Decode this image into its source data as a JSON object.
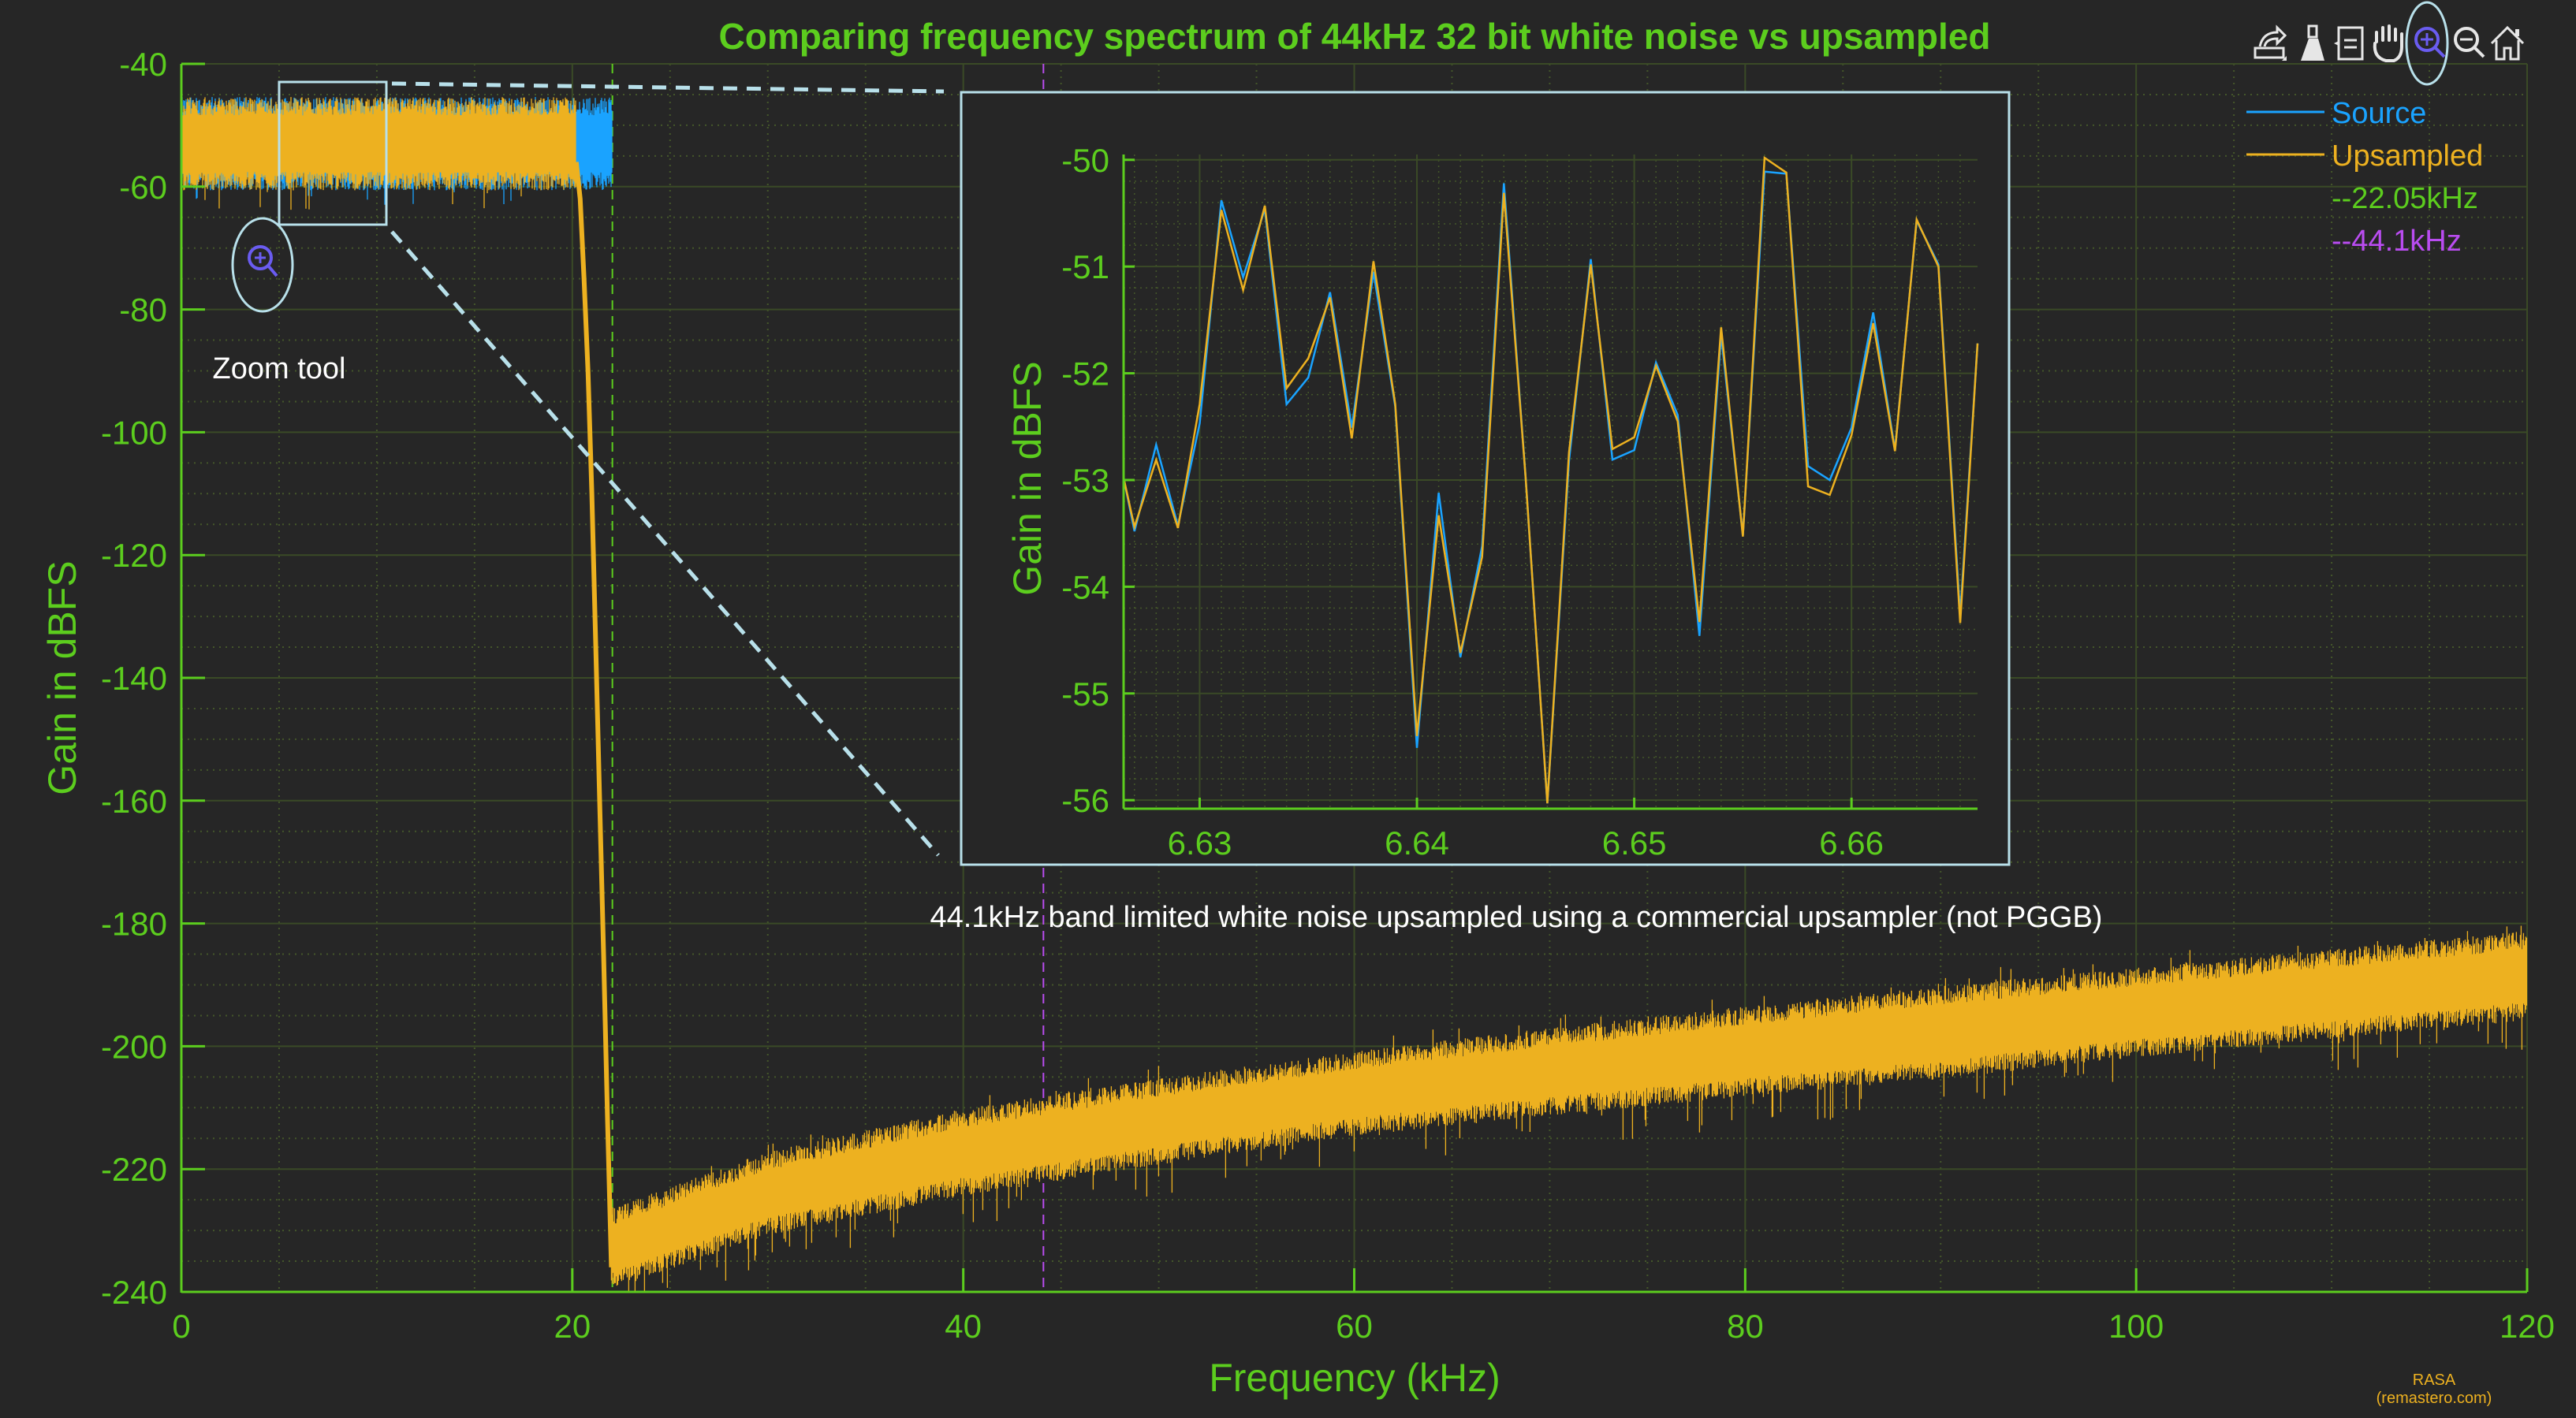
{
  "colors": {
    "background": "#262626",
    "axis": "#5ccd1e",
    "grid_major": "#3a4a26",
    "grid_minor": "#44562a",
    "source": "#1aa3ff",
    "upsampled": "#edb120",
    "marker_22k": "#5ccd1e",
    "marker_44k": "#b94cf0",
    "annotation": "#b8e0ea",
    "zoom_icon": "#6a5cf0",
    "text_white": "#ffffff",
    "credit": "#edb120"
  },
  "toolbar": {
    "items": [
      {
        "name": "export-icon",
        "label": "Export"
      },
      {
        "name": "brush-icon",
        "label": "Brush"
      },
      {
        "name": "datatip-icon",
        "label": "Data tips"
      },
      {
        "name": "pan-icon",
        "label": "Pan"
      },
      {
        "name": "zoom-in-icon",
        "label": "Zoom in",
        "active": true
      },
      {
        "name": "zoom-out-icon",
        "label": "Zoom out"
      },
      {
        "name": "home-icon",
        "label": "Restore view"
      }
    ]
  },
  "annotations": {
    "zoom_tool_label": "Zoom tool",
    "description": "44.1kHz band limited white noise  upsampled using a commercial upsampler (not PGGB)",
    "credit_line1": "RASA",
    "credit_line2": "(remastero.com)"
  },
  "chart_data": [
    {
      "id": "main",
      "type": "area",
      "title": "Comparing frequency spectrum of 44kHz 32 bit white noise vs upsampled",
      "xlabel": "Frequency (kHz)",
      "ylabel": "Gain in dBFS",
      "xlim": [
        0,
        120
      ],
      "ylim": [
        -240,
        -40
      ],
      "xticks": [
        0,
        20,
        40,
        60,
        80,
        100,
        120
      ],
      "xtick_labels": [
        "0",
        "20",
        "40",
        "60",
        "80",
        "100",
        "120"
      ],
      "yticks": [
        -40,
        -60,
        -80,
        -100,
        -120,
        -140,
        -160,
        -180,
        -200,
        -220,
        -240
      ],
      "ytick_labels": [
        "-40",
        "-60",
        "-80",
        "-100",
        "-120",
        "-140",
        "-160",
        "-180",
        "-200",
        "-220",
        "-240"
      ],
      "grid": true,
      "minor_grid": true,
      "legend_position": "top-right",
      "legend": [
        {
          "label": "Source",
          "style": "line",
          "color_key": "source"
        },
        {
          "label": "Upsampled",
          "style": "line",
          "color_key": "upsampled"
        },
        {
          "label": "--22.05kHz",
          "style": "text",
          "color_key": "marker_22k"
        },
        {
          "label": "--44.1kHz",
          "style": "text",
          "color_key": "marker_44k"
        }
      ],
      "vertical_markers": [
        {
          "x": 22.05,
          "label": "22.05kHz",
          "color_key": "marker_22k",
          "style": "dashed"
        },
        {
          "x": 44.1,
          "label": "44.1kHz",
          "color_key": "marker_44k",
          "style": "dashed"
        }
      ],
      "series": [
        {
          "name": "Source",
          "color_key": "source",
          "description": "White noise band, flat from 0 to 22.05 kHz",
          "envelope": {
            "x": [
              0,
              22.05
            ],
            "upper": [
              -47.5,
              -47.5
            ],
            "lower": [
              -58.5,
              -58.5
            ],
            "spike_min": -63
          }
        },
        {
          "name": "Upsampled",
          "color_key": "upsampled",
          "description": "Flat noise to ~20 kHz, steep roll-off to ~-236 dB by 22 kHz, then rising noise floor",
          "passband": {
            "x": [
              0,
              20.2
            ],
            "upper": -47.5,
            "lower": -58.5
          },
          "rolloff": {
            "x": [
              20.2,
              20.4,
              20.6,
              20.8,
              21.0,
              21.2,
              21.4,
              21.6,
              21.8,
              22.0
            ],
            "y": [
              -56,
              -62,
              -75,
              -90,
              -110,
              -135,
              -160,
              -185,
              -212,
              -236
            ]
          },
          "noise_floor": {
            "x": [
              22,
              30,
              40,
              50,
              60,
              70,
              80,
              90,
              100,
              110,
              120
            ],
            "upper": [
              -228,
              -219,
              -212,
              -207,
              -202.6,
              -198.8,
              -195.3,
              -192,
              -189,
              -186,
              -183
            ],
            "lower": [
              -238,
              -229,
              -222.6,
              -217.5,
              -212.8,
              -209.5,
              -206.4,
              -203.5,
              -200,
              -197,
              -194
            ]
          }
        }
      ],
      "zoom_region": {
        "x": [
          5,
          10.5
        ],
        "y": [
          -43,
          -66
        ]
      }
    },
    {
      "id": "inset",
      "type": "line",
      "title": "",
      "xlabel": "",
      "ylabel": "Gain in dBFS",
      "xlim": [
        6.6265,
        6.6658
      ],
      "ylim": [
        -56.08,
        -49.95
      ],
      "xticks": [
        6.63,
        6.64,
        6.65,
        6.66
      ],
      "xtick_labels": [
        "6.63",
        "6.64",
        "6.65",
        "6.66"
      ],
      "yticks": [
        -50,
        -51,
        -52,
        -53,
        -54,
        -55,
        -56
      ],
      "ytick_labels": [
        "-50",
        "-51",
        "-52",
        "-53",
        "-54",
        "-55",
        "-56"
      ],
      "grid": true,
      "minor_grid": true,
      "x": [
        6.6265,
        6.627,
        6.628,
        6.629,
        6.63,
        6.631,
        6.632,
        6.633,
        6.634,
        6.635,
        6.636,
        6.637,
        6.638,
        6.639,
        6.64,
        6.641,
        6.642,
        6.643,
        6.644,
        6.645,
        6.646,
        6.647,
        6.648,
        6.649,
        6.65,
        6.651,
        6.652,
        6.653,
        6.654,
        6.655,
        6.656,
        6.657,
        6.658,
        6.659,
        6.66,
        6.661,
        6.662,
        6.663,
        6.664,
        6.665,
        6.6658
      ],
      "series": [
        {
          "name": "Source",
          "color_key": "source",
          "values": [
            -52.98,
            -53.48,
            -52.67,
            -53.43,
            -52.47,
            -50.38,
            -51.1,
            -50.46,
            -52.29,
            -52.04,
            -51.24,
            -52.51,
            -51.05,
            -52.31,
            -55.51,
            -53.12,
            -54.66,
            -53.62,
            -50.22,
            -52.97,
            -56.03,
            -52.82,
            -50.93,
            -52.81,
            -52.72,
            -51.9,
            -52.39,
            -54.46,
            -51.64,
            -53.52,
            -50.11,
            -50.13,
            -52.87,
            -53.0,
            -52.51,
            -51.43,
            -52.72,
            -50.57,
            -50.98,
            -54.27,
            -51.72
          ]
        },
        {
          "name": "Upsampled",
          "color_key": "upsampled",
          "values": [
            -52.98,
            -53.44,
            -52.81,
            -53.45,
            -52.29,
            -50.47,
            -51.22,
            -50.43,
            -52.14,
            -51.86,
            -51.29,
            -52.61,
            -50.95,
            -52.29,
            -55.4,
            -53.33,
            -54.62,
            -53.72,
            -50.31,
            -52.97,
            -56.03,
            -52.74,
            -50.98,
            -52.71,
            -52.6,
            -51.93,
            -52.45,
            -54.33,
            -51.57,
            -53.53,
            -49.98,
            -50.12,
            -53.06,
            -53.14,
            -52.58,
            -51.53,
            -52.73,
            -50.56,
            -51.0,
            -54.34,
            -51.72
          ]
        }
      ]
    }
  ]
}
